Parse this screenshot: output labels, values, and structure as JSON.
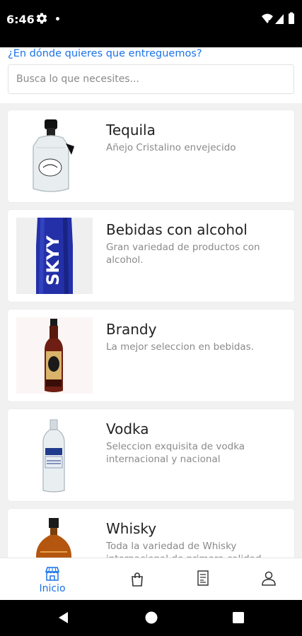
{
  "status_bar": {
    "time": "6:46",
    "icons": [
      "gear-icon",
      "notification-dot-icon",
      "wifi-icon",
      "cell-signal-icon",
      "battery-icon"
    ]
  },
  "header": {
    "delivery_prompt": "¿En dónde quieres que entreguemos?",
    "search_placeholder": "Busca lo que necesites..."
  },
  "categories": [
    {
      "title": "Tequila",
      "description": "Añejo Cristalino envejecido",
      "image": "tequila-bottle-image"
    },
    {
      "title": "Bebidas con alcohol",
      "description": "Gran variedad de productos con alcohol.",
      "image": "skyy-bottle-image"
    },
    {
      "title": "Brandy",
      "description": "La mejor seleccion en bebidas.",
      "image": "brandy-bottle-image"
    },
    {
      "title": "Vodka",
      "description": "Seleccion exquisita de vodka internacional y nacional",
      "image": "vodka-bottle-image"
    },
    {
      "title": "Whisky",
      "description": "Toda la variedad de Whisky internacional de primera calidad",
      "image": "whisky-bottle-image"
    }
  ],
  "bottom_nav": {
    "home_label": "Inicio",
    "active_color": "#1a73e8",
    "items": [
      "store-icon",
      "shopping-bag-icon",
      "receipt-icon",
      "user-icon"
    ]
  },
  "colors": {
    "accent": "#1a73e8",
    "background": "#f1f1f1",
    "card": "#ffffff"
  }
}
